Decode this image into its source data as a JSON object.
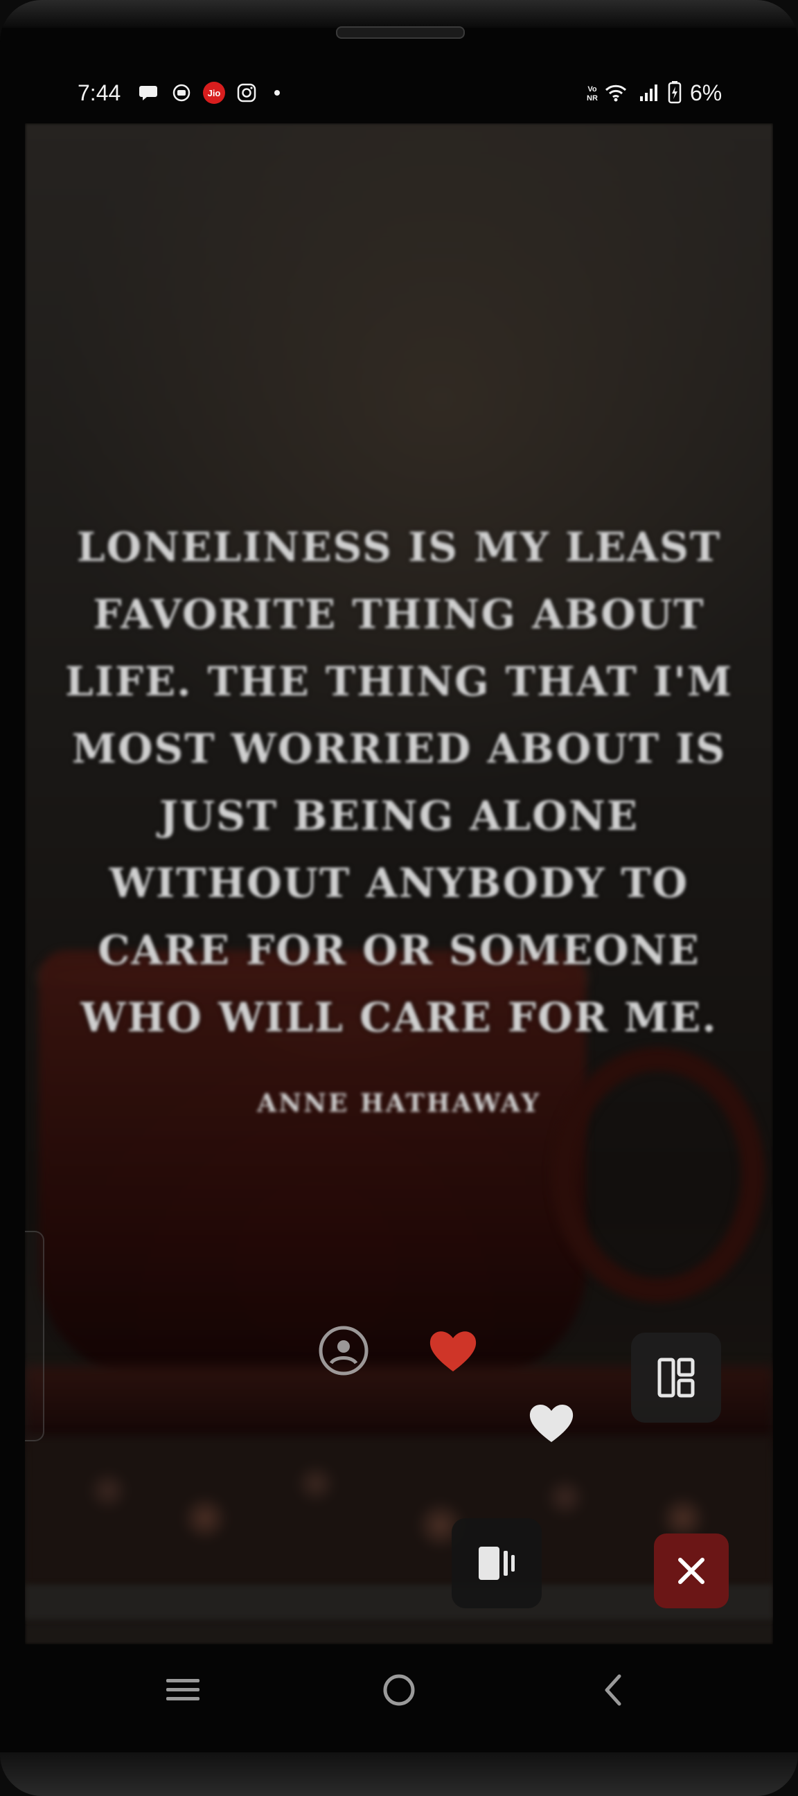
{
  "status_bar": {
    "time": "7:44",
    "left_icons": [
      "chat-bubble-icon",
      "screen-record-icon",
      "jio-icon",
      "instagram-icon",
      "dot-icon"
    ],
    "jio_label": "Jio",
    "right_icons": [
      "vonr-icon",
      "wifi-icon",
      "signal-icon",
      "battery-icon"
    ],
    "vonr_label": "Vo NR",
    "battery_percent": "6%"
  },
  "quote": {
    "text": "Loneliness is my least favorite thing about life. The thing that I'm most worried about is just being alone without anybody to care for or someone who will care for me.",
    "author": "Anne Hathaway"
  },
  "actions": {
    "save_icon": "download-circle-icon",
    "like_icon": "heart-icon",
    "like_color": "#e0392b",
    "layout_icon": "layout-panels-icon",
    "favorite_icon": "heart-outline-icon",
    "reel_icon": "reel-icon",
    "close_icon": "close-icon",
    "close_color": "#6b1616"
  },
  "nav_bar": {
    "icons": [
      "recents-icon",
      "home-icon",
      "back-icon"
    ]
  }
}
